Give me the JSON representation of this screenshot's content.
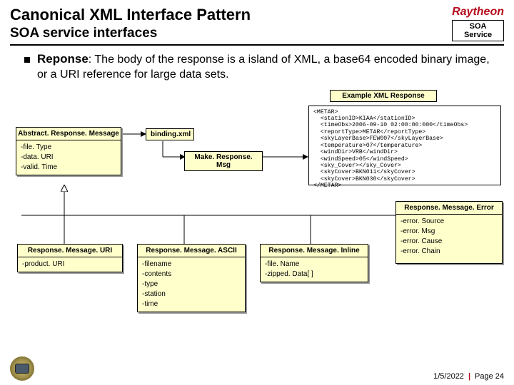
{
  "header": {
    "title": "Canonical XML Interface Pattern",
    "subtitle": "SOA service interfaces",
    "brand": "Raytheon",
    "service_box_line1": "SOA",
    "service_box_line2": "Service"
  },
  "bullet": {
    "lead": "Reponse",
    "colon": ": ",
    "body": "The body of the response is a island of XML, a base64 encoded binary image, or a URI reference for large data sets."
  },
  "diagram": {
    "example_label": "Example XML Response",
    "binding_label": "binding.xml",
    "make_label": "Make. Response. Msg",
    "abstract": {
      "title": "Abstract. Response. Message",
      "attrs": [
        "-file. Type",
        "-data. URI",
        "-valid. Time"
      ]
    },
    "uri": {
      "title": "Response. Message. URI",
      "attrs": [
        "-product. URI"
      ]
    },
    "ascii": {
      "title": "Response. Message. ASCII",
      "attrs": [
        "-filename",
        "-contents",
        "-type",
        "-station",
        "-time"
      ]
    },
    "inline": {
      "title": "Response. Message. Inline",
      "attrs": [
        "-file. Name",
        "-zipped. Data[ ]"
      ]
    },
    "error": {
      "title": "Response. Message. Error",
      "attrs": [
        "-error. Source",
        "-error. Msg",
        "-error. Cause",
        "-error. Chain"
      ]
    },
    "xml_sample": "<METAR>\n  <stationID>KIAA</stationID>\n  <timeObs>2006-09-10 02:00:00:000</timeObs>\n  <reportType>METAR</reportType>\n  <skyLayerBase>FEW007</skyLayerBase>\n  <temperature>07</temperature>\n  <windDir>VRB</windDir>\n  <windSpeed>05</windSpeed>\n  <sky_Cover></sky_Cover>\n  <skyCover>BKN011</skyCover>\n  <skyCover>BKN030</skyCover>\n</METAR>"
  },
  "footer": {
    "date": "1/5/2022",
    "page": "Page 24"
  }
}
